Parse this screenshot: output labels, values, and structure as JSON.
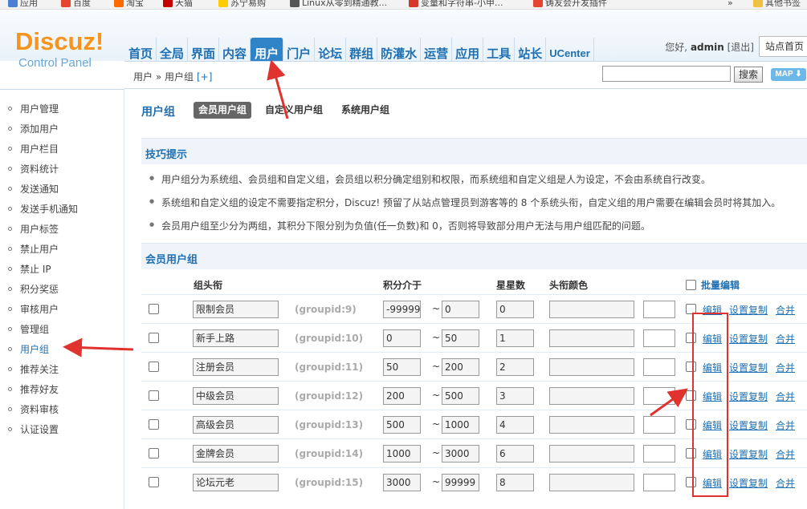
{
  "bookmarks": [
    {
      "label": "应用",
      "color": "#4a7fd4"
    },
    {
      "label": "百度",
      "color": "#e5442f"
    },
    {
      "label": "淘宝",
      "color": "#ff6a00"
    },
    {
      "label": "天猫",
      "color": "#c40000"
    },
    {
      "label": "苏宁易购",
      "color": "#ffcc00"
    },
    {
      "label": "Linux从零到精通教...",
      "color": "#555555"
    },
    {
      "label": "变量和字符串-小甲...",
      "color": "#d6372b"
    },
    {
      "label": "铸友会开发插件",
      "color": "#e5442f"
    },
    {
      "label": "»",
      "color": ""
    },
    {
      "label": "其他书签",
      "color": "#f0c040"
    }
  ],
  "logo": {
    "title": "Discuz",
    "bang": "!",
    "subtitle": "Control Panel"
  },
  "nav": [
    "首页",
    "全局",
    "界面",
    "内容",
    "用户",
    "门户",
    "论坛",
    "群组",
    "防灌水",
    "运营",
    "应用",
    "工具",
    "站长",
    "UCenter"
  ],
  "nav_active": "用户",
  "user": {
    "greeting": "您好,",
    "name": "admin",
    "logout": "[退出]",
    "site_home": "站点首页"
  },
  "breadcrumb": {
    "text": "用户 » 用户组",
    "add": "[+]"
  },
  "search": {
    "button": "搜索",
    "map": "MAP ⬇"
  },
  "sidebar": [
    "用户管理",
    "添加用户",
    "用户栏目",
    "资料统计",
    "发送通知",
    "发送手机通知",
    "用户标签",
    "禁止用户",
    "禁止 IP",
    "积分奖惩",
    "审核用户",
    "管理组",
    "用户组",
    "推荐关注",
    "推荐好友",
    "资料审核",
    "认证设置"
  ],
  "sidebar_active": "用户组",
  "page": {
    "title": "用户组",
    "tabs": [
      "会员用户组",
      "自定义用户组",
      "系统用户组"
    ],
    "tips_title": "技巧提示",
    "tips": [
      "用户组分为系统组、会员组和自定义组，会员组以积分确定组别和权限，而系统组和自定义组是人为设定，不会由系统自行改变。",
      "系统组和自定义组的设定不需要指定积分，Discuz! 预留了从站点管理员到游客等的 8 个系统头衔，自定义组的用户需要在编辑会员时将其加入。",
      "会员用户组至少分为两组，其积分下限分别为负值(任一负数)和 0，否则将导致部分用户无法与用户组匹配的问题。"
    ],
    "group_section": "会员用户组",
    "columns": {
      "title": "组头衔",
      "credits": "积分介于",
      "stars": "星星数",
      "color": "头衔颜色",
      "batch": "批量编辑"
    },
    "rows": [
      {
        "name": "限制会员",
        "gid": "(groupid:9)",
        "from": "-99999",
        "to": "0",
        "stars": "0"
      },
      {
        "name": "新手上路",
        "gid": "(groupid:10)",
        "from": "0",
        "to": "50",
        "stars": "1"
      },
      {
        "name": "注册会员",
        "gid": "(groupid:11)",
        "from": "50",
        "to": "200",
        "stars": "2"
      },
      {
        "name": "中级会员",
        "gid": "(groupid:12)",
        "from": "200",
        "to": "500",
        "stars": "3"
      },
      {
        "name": "高级会员",
        "gid": "(groupid:13)",
        "from": "500",
        "to": "1000",
        "stars": "4"
      },
      {
        "name": "金牌会员",
        "gid": "(groupid:14)",
        "from": "1000",
        "to": "3000",
        "stars": "6"
      },
      {
        "name": "论坛元老",
        "gid": "(groupid:15)",
        "from": "3000",
        "to": "99999",
        "stars": "8"
      }
    ],
    "row_actions": {
      "tilde": "~",
      "edit": "编辑",
      "copy": "设置复制",
      "merge": "合并"
    }
  },
  "colors": {
    "accent": "#1f6fb1",
    "logo": "#f7941e",
    "annotation": "#e0322e"
  }
}
